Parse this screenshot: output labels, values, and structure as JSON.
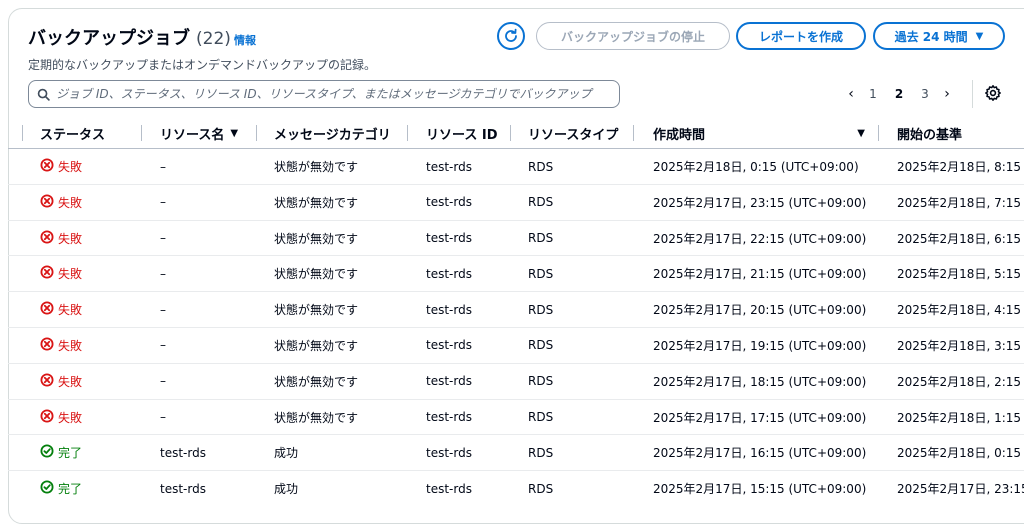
{
  "header": {
    "title": "バックアップジョブ",
    "count": "(22)",
    "info": "情報",
    "subtitle": "定期的なバックアップまたはオンデマンドバックアップの記録。"
  },
  "toolbar": {
    "stop_label": "バックアップジョブの停止",
    "report_label": "レポートを作成",
    "range_label": "過去 24 時間"
  },
  "search": {
    "placeholder": "ジョブ ID、ステータス、リソース ID、リソースタイプ、またはメッセージカテゴリでバックアップ"
  },
  "pagination": {
    "pages": [
      "1",
      "2",
      "3"
    ],
    "current": "2"
  },
  "columns": {
    "status": "ステータス",
    "resource_name": "リソース名",
    "message_category": "メッセージカテゴリ",
    "resource_id": "リソース ID",
    "resource_type": "リソースタイプ",
    "created": "作成時間",
    "started": "開始の基準"
  },
  "rows": [
    {
      "status": "失敗",
      "state": "fail",
      "resource_name": "–",
      "message": "状態が無効です",
      "resource_id": "test-rds",
      "resource_type": "RDS",
      "created": "2025年2月18日, 0:15 (UTC+09:00)",
      "started": "2025年2月18日, 8:15 ("
    },
    {
      "status": "失敗",
      "state": "fail",
      "resource_name": "–",
      "message": "状態が無効です",
      "resource_id": "test-rds",
      "resource_type": "RDS",
      "created": "2025年2月17日, 23:15 (UTC+09:00)",
      "started": "2025年2月18日, 7:15 ("
    },
    {
      "status": "失敗",
      "state": "fail",
      "resource_name": "–",
      "message": "状態が無効です",
      "resource_id": "test-rds",
      "resource_type": "RDS",
      "created": "2025年2月17日, 22:15 (UTC+09:00)",
      "started": "2025年2月18日, 6:15 ("
    },
    {
      "status": "失敗",
      "state": "fail",
      "resource_name": "–",
      "message": "状態が無効です",
      "resource_id": "test-rds",
      "resource_type": "RDS",
      "created": "2025年2月17日, 21:15 (UTC+09:00)",
      "started": "2025年2月18日, 5:15 ("
    },
    {
      "status": "失敗",
      "state": "fail",
      "resource_name": "–",
      "message": "状態が無効です",
      "resource_id": "test-rds",
      "resource_type": "RDS",
      "created": "2025年2月17日, 20:15 (UTC+09:00)",
      "started": "2025年2月18日, 4:15 ("
    },
    {
      "status": "失敗",
      "state": "fail",
      "resource_name": "–",
      "message": "状態が無効です",
      "resource_id": "test-rds",
      "resource_type": "RDS",
      "created": "2025年2月17日, 19:15 (UTC+09:00)",
      "started": "2025年2月18日, 3:15 ("
    },
    {
      "status": "失敗",
      "state": "fail",
      "resource_name": "–",
      "message": "状態が無効です",
      "resource_id": "test-rds",
      "resource_type": "RDS",
      "created": "2025年2月17日, 18:15 (UTC+09:00)",
      "started": "2025年2月18日, 2:15 ("
    },
    {
      "status": "失敗",
      "state": "fail",
      "resource_name": "–",
      "message": "状態が無効です",
      "resource_id": "test-rds",
      "resource_type": "RDS",
      "created": "2025年2月17日, 17:15 (UTC+09:00)",
      "started": "2025年2月18日, 1:15 ("
    },
    {
      "status": "完了",
      "state": "ok",
      "resource_name": "test-rds",
      "message": "成功",
      "resource_id": "test-rds",
      "resource_type": "RDS",
      "created": "2025年2月17日, 16:15 (UTC+09:00)",
      "started": "2025年2月18日, 0:15 ("
    },
    {
      "status": "完了",
      "state": "ok",
      "resource_name": "test-rds",
      "message": "成功",
      "resource_id": "test-rds",
      "resource_type": "RDS",
      "created": "2025年2月17日, 15:15 (UTC+09:00)",
      "started": "2025年2月17日, 23:15"
    }
  ],
  "colors": {
    "accent": "#0972d3",
    "fail": "#d91515",
    "success": "#037f0c",
    "border": "#d5dbdb"
  },
  "icons": {
    "refresh": "refresh-icon",
    "search": "search-icon",
    "prev": "chevron-left-icon",
    "next": "chevron-right-icon",
    "settings": "gear-icon",
    "fail": "error-circle-icon",
    "ok": "check-circle-icon",
    "sort": "caret-down-icon"
  }
}
